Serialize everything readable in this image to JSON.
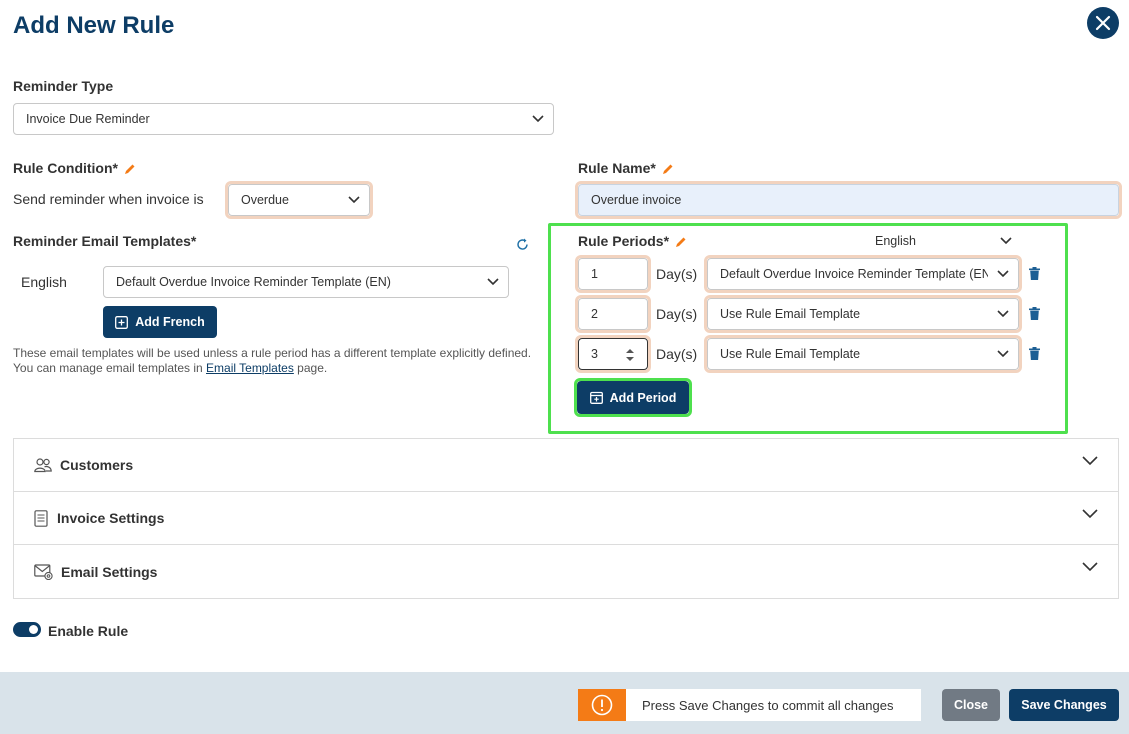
{
  "header": {
    "title": "Add New Rule"
  },
  "reminder_type": {
    "label": "Reminder Type",
    "value": "Invoice Due Reminder"
  },
  "rule_condition": {
    "label": "Rule Condition*",
    "sentence": "Send reminder when invoice is",
    "value": "Overdue"
  },
  "rule_name": {
    "label": "Rule Name*",
    "value": "Overdue invoice"
  },
  "email_templates": {
    "label": "Reminder Email Templates*",
    "language": "English",
    "template": "Default Overdue Invoice Reminder Template (EN)",
    "add_button": "Add French",
    "help_prefix": "These email templates will be used unless a rule period has a different template explicitly defined. You can manage email templates in ",
    "help_link": "Email Templates",
    "help_suffix": " page."
  },
  "rule_periods": {
    "label": "Rule Periods*",
    "language": "English",
    "unit": "Day(s)",
    "rows": [
      {
        "days": "1",
        "template": "Default Overdue Invoice Reminder Template (EN)"
      },
      {
        "days": "2",
        "template": "Use Rule Email Template"
      },
      {
        "days": "3",
        "template": "Use Rule Email Template"
      }
    ],
    "add_button": "Add Period"
  },
  "sections": [
    {
      "label": "Customers",
      "icon": "people-icon"
    },
    {
      "label": "Invoice Settings",
      "icon": "document-icon"
    },
    {
      "label": "Email Settings",
      "icon": "email-at-icon"
    }
  ],
  "enable_rule": {
    "label": "Enable Rule",
    "enabled": true
  },
  "footer": {
    "notice": "Press Save Changes to commit all changes",
    "close": "Close",
    "save": "Save Changes"
  },
  "colors": {
    "primary": "#0d3d66",
    "highlight_border": "#f2d3bf",
    "focus_green": "#4ee04e",
    "warning": "#f47b16"
  }
}
